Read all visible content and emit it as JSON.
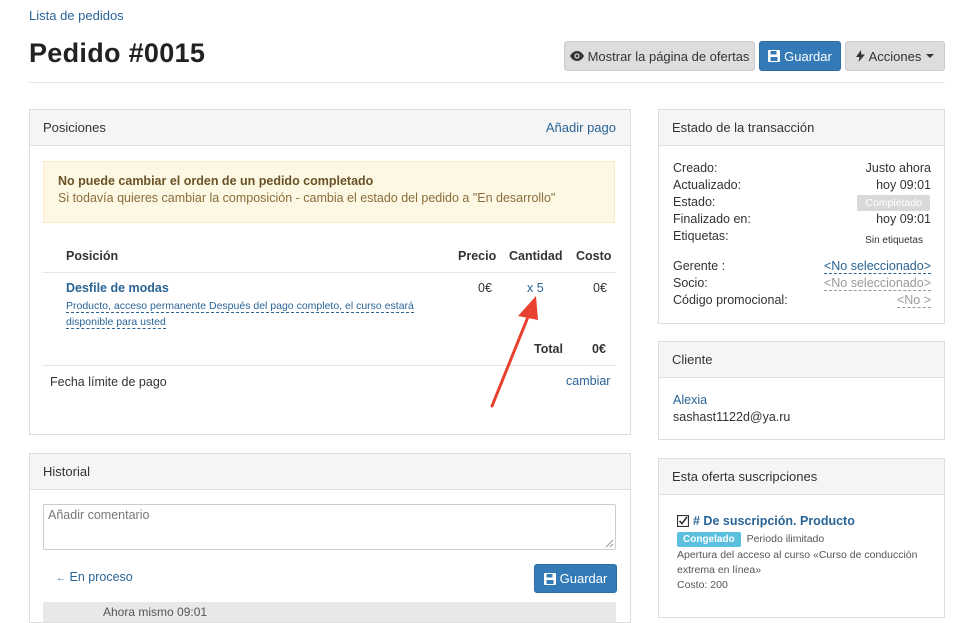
{
  "breadcrumb": "Lista de pedidos",
  "title": "Pedido #0015",
  "toolbar": {
    "show_offer_label": "Mostrar la página de ofertas",
    "save_label": "Guardar",
    "actions_label": "Acciones"
  },
  "positions": {
    "header": "Posiciones",
    "add_payment": "Añadir pago",
    "alert_title": "No puede cambiar el orden de un pedido completado",
    "alert_text": "Si todavía quieres cambiar la composición - cambia el estado del pedido a \"En desarrollo\"",
    "columns": [
      "Posición",
      "Precio",
      "Cantidad",
      "Costo"
    ],
    "item": {
      "name": "Desfile de modas",
      "desc_line1": "Producto, acceso permanente Después del pago completo, el curso estará",
      "desc_line2": "disponible para usted",
      "price": "0€",
      "qty": "x 5",
      "cost": "0€"
    },
    "total_label": "Total",
    "total_value": "0€",
    "due_label": "Fecha límite de pago",
    "change_label": "cambiar"
  },
  "history": {
    "header": "Historial",
    "comment_placeholder": "Añadir comentario",
    "status_link": "En proceso",
    "save_label": "Guardar",
    "next_row_partial": "Ahora mismo 09:01"
  },
  "transaction": {
    "header": "Estado de la transacción",
    "created_label": "Creado:",
    "created_value": "Justo ahora",
    "updated_label": "Actualizado:",
    "updated_value": "hoy 09:01",
    "status_label": "Estado:",
    "status_value": "Completado",
    "finished_label": "Finalizado en:",
    "finished_value": "hoy 09:01",
    "tags_label": "Etiquetas:",
    "tags_value": "Sin etiquetas",
    "manager_label": "Gerente :",
    "manager_value": "<No seleccionado>",
    "partner_label": "Socio:",
    "partner_value": "<No seleccionado>",
    "promo_label": "Código promocional:",
    "promo_value": "<No >"
  },
  "client": {
    "header": "Cliente",
    "name": "Alexia",
    "email": "sashast1122d@ya.ru"
  },
  "subscriptions": {
    "header": "Esta oferta suscripciones",
    "title": "# De suscripción. Producto",
    "badge": "Congelado",
    "period": "Periodo ilimitado",
    "desc_line1": "Apertura del acceso al curso «Curso de conducción",
    "desc_line2": "extrema en línea»",
    "cost": "Costo: 200"
  },
  "colors": {
    "primary": "#337ab7",
    "link": "#2a6496",
    "alert_bg": "#fcf8e3",
    "arrow": "#e8412f"
  }
}
